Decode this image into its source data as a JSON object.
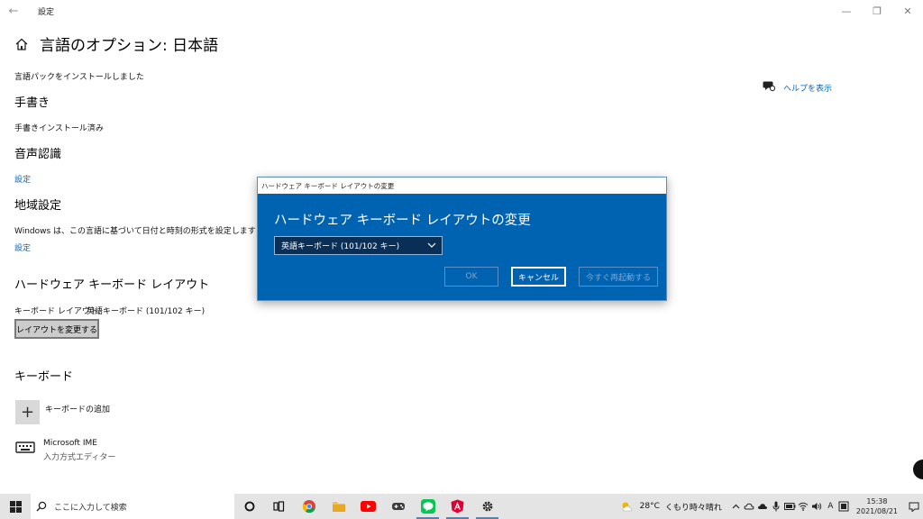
{
  "window": {
    "title": "設定",
    "back_glyph": "←",
    "minimize_glyph": "—",
    "maximize_glyph": "❐",
    "close_glyph": "✕"
  },
  "page": {
    "title": "言語のオプション: 日本語",
    "lang_pack_status": "言語パックをインストールしました",
    "help_link": "ヘルプを表示",
    "handwriting": {
      "heading": "手書き",
      "status": "手書きインストール済み"
    },
    "speech": {
      "heading": "音声認識",
      "link": "設定"
    },
    "region": {
      "heading": "地域設定",
      "description": "Windows は、この言語に基づいて日付と時刻の形式を設定します",
      "link": "設定"
    },
    "hardware_kb": {
      "heading": "ハードウェア キーボード レイアウト",
      "current_label": "キーボード レイアウト:",
      "current_value": "英語キーボード (101/102 キー)",
      "change_button": "レイアウトを変更する"
    },
    "keyboards": {
      "heading": "キーボード",
      "add_label": "キーボードの追加",
      "add_glyph": "+",
      "items": [
        {
          "name": "Microsoft IME",
          "subtitle": "入力方式エディター"
        }
      ]
    }
  },
  "dialog": {
    "window_title": "ハードウェア キーボード レイアウトの変更",
    "heading": "ハードウェア キーボード レイアウトの変更",
    "selected_layout": "英語キーボード (101/102 キー)",
    "ok_label": "OK",
    "cancel_label": "キャンセル",
    "restart_label": "今すぐ再起動する"
  },
  "taskbar": {
    "search_placeholder": "ここに入力して検索",
    "apps": [
      "cortana-icon",
      "task-view-icon",
      "chrome-icon",
      "file-explorer-icon",
      "youtube-icon",
      "game-icon",
      "line-icon",
      "angular-icon",
      "settings-icon"
    ],
    "weather_temp": "28°C",
    "weather_text": "くもり時々晴れ",
    "ime_mode": "A",
    "time": "15:38",
    "date": "2021/08/21"
  },
  "colors": {
    "dialog_bg": "#0063b1",
    "link": "#0067c0",
    "taskbar_bg": "#e4e4e4"
  }
}
